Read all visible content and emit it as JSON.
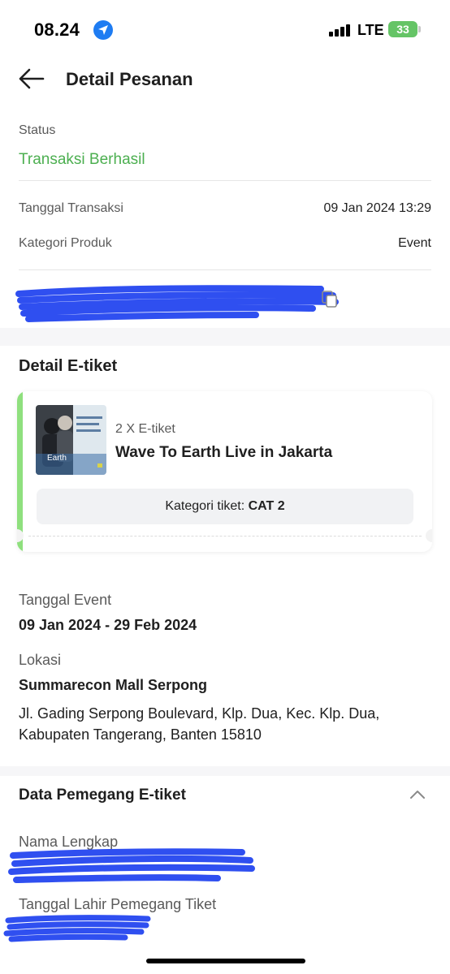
{
  "status_bar": {
    "time": "08.24",
    "network": "LTE",
    "battery": "33",
    "icons": [
      "location-arrow-icon",
      "signal-bars-icon",
      "battery-charging-icon"
    ]
  },
  "header": {
    "title": "Detail Pesanan",
    "back_icon": "arrow-left-icon"
  },
  "order": {
    "status_label": "Status",
    "status_value": "Transaksi Berhasil",
    "rows": [
      {
        "label": "Tanggal Transaksi",
        "value": "09 Jan 2024 13:29"
      },
      {
        "label": "Kategori Produk",
        "value": "Event"
      }
    ],
    "copy_icon": "copy-icon"
  },
  "eticket": {
    "section_title": "Detail E-tiket",
    "qty": "2 X E-tiket",
    "event_name": "Wave To Earth Live in Jakarta",
    "category_label": "Kategori tiket: ",
    "category_value": "CAT 2",
    "thumb_text": "Earth"
  },
  "event_info": {
    "date_label": "Tanggal Event",
    "date_value": "09 Jan 2024 - 29 Feb 2024",
    "location_label": "Lokasi",
    "location_name": "Summarecon Mall Serpong",
    "location_address": "Jl. Gading Serpong Boulevard, Klp. Dua, Kec. Klp. Dua, Kabupaten Tangerang, Banten 15810"
  },
  "holder": {
    "section_title": "Data Pemegang E-tiket",
    "toggle_icon": "chevron-up-icon",
    "full_name_label": "Nama Lengkap",
    "birth_date_label": "Tanggal Lahir Pemegang Tiket"
  },
  "colors": {
    "success": "#4caf50",
    "accent_bar": "#8fe07e",
    "redaction": "#2f4ff0",
    "location_dot": "#1e7cf2",
    "battery": "#65c466"
  }
}
